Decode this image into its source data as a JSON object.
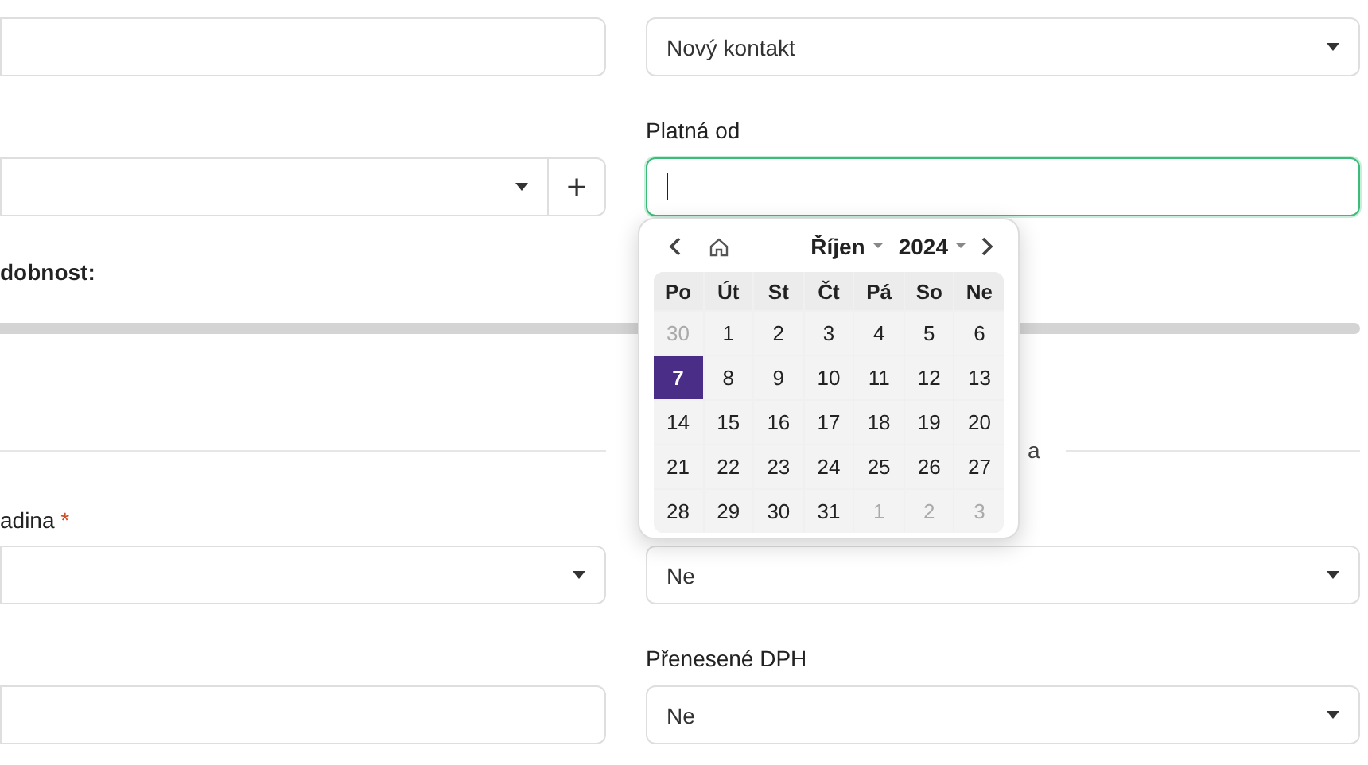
{
  "contact_select": {
    "value": "Nový kontakt"
  },
  "valid_from": {
    "label": "Platná od",
    "focused": true
  },
  "add_button": "+",
  "slider": {
    "label": "dobnost:"
  },
  "section_text": "a",
  "required_field": {
    "label": "adina",
    "required_mark": "*"
  },
  "select_ne": {
    "value": "Ne"
  },
  "reverse_charge": {
    "label": "Přenesené DPH",
    "value": "Ne"
  },
  "calendar": {
    "month": "Říjen",
    "year": "2024",
    "weekdays": [
      "Po",
      "Út",
      "St",
      "Čt",
      "Pá",
      "So",
      "Ne"
    ],
    "weeks": [
      [
        {
          "day": "30",
          "outside": true,
          "selected": false
        },
        {
          "day": "1",
          "outside": false,
          "selected": false
        },
        {
          "day": "2",
          "outside": false,
          "selected": false
        },
        {
          "day": "3",
          "outside": false,
          "selected": false
        },
        {
          "day": "4",
          "outside": false,
          "selected": false
        },
        {
          "day": "5",
          "outside": false,
          "selected": false
        },
        {
          "day": "6",
          "outside": false,
          "selected": false
        }
      ],
      [
        {
          "day": "7",
          "outside": false,
          "selected": true
        },
        {
          "day": "8",
          "outside": false,
          "selected": false
        },
        {
          "day": "9",
          "outside": false,
          "selected": false
        },
        {
          "day": "10",
          "outside": false,
          "selected": false
        },
        {
          "day": "11",
          "outside": false,
          "selected": false
        },
        {
          "day": "12",
          "outside": false,
          "selected": false
        },
        {
          "day": "13",
          "outside": false,
          "selected": false
        }
      ],
      [
        {
          "day": "14",
          "outside": false,
          "selected": false
        },
        {
          "day": "15",
          "outside": false,
          "selected": false
        },
        {
          "day": "16",
          "outside": false,
          "selected": false
        },
        {
          "day": "17",
          "outside": false,
          "selected": false
        },
        {
          "day": "18",
          "outside": false,
          "selected": false
        },
        {
          "day": "19",
          "outside": false,
          "selected": false
        },
        {
          "day": "20",
          "outside": false,
          "selected": false
        }
      ],
      [
        {
          "day": "21",
          "outside": false,
          "selected": false
        },
        {
          "day": "22",
          "outside": false,
          "selected": false
        },
        {
          "day": "23",
          "outside": false,
          "selected": false
        },
        {
          "day": "24",
          "outside": false,
          "selected": false
        },
        {
          "day": "25",
          "outside": false,
          "selected": false
        },
        {
          "day": "26",
          "outside": false,
          "selected": false
        },
        {
          "day": "27",
          "outside": false,
          "selected": false
        }
      ],
      [
        {
          "day": "28",
          "outside": false,
          "selected": false
        },
        {
          "day": "29",
          "outside": false,
          "selected": false
        },
        {
          "day": "30",
          "outside": false,
          "selected": false
        },
        {
          "day": "31",
          "outside": false,
          "selected": false
        },
        {
          "day": "1",
          "outside": true,
          "selected": false
        },
        {
          "day": "2",
          "outside": true,
          "selected": false
        },
        {
          "day": "3",
          "outside": true,
          "selected": false
        }
      ]
    ]
  }
}
